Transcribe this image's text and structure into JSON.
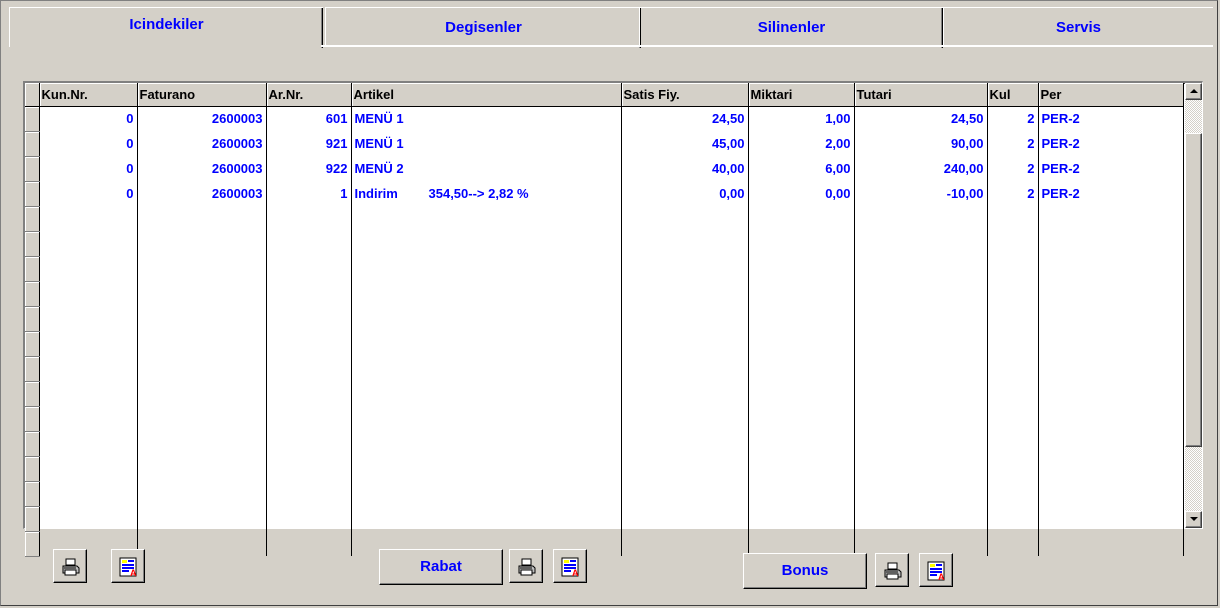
{
  "tabs": [
    {
      "label": "Icindekiler",
      "active": true
    },
    {
      "label": "Degisenler",
      "active": false
    },
    {
      "label": "Silinenler",
      "active": false
    },
    {
      "label": "Servis",
      "active": false
    }
  ],
  "grid": {
    "columns": [
      "Kun.Nr.",
      "Faturano",
      "Ar.Nr.",
      "Artikel",
      "Satis Fiy.",
      "Miktari",
      "Tutari",
      "Kul",
      "Per"
    ],
    "rows": [
      {
        "kun": "0",
        "fatura": "2600003",
        "ar": "601",
        "artikel": "MENÜ 1",
        "discount": "",
        "satis": "24,50",
        "miktar": "1,00",
        "tutar": "24,50",
        "kul": "2",
        "per": "PER-2"
      },
      {
        "kun": "0",
        "fatura": "2600003",
        "ar": "921",
        "artikel": "MENÜ 1",
        "discount": "",
        "satis": "45,00",
        "miktar": "2,00",
        "tutar": "90,00",
        "kul": "2",
        "per": "PER-2"
      },
      {
        "kun": "0",
        "fatura": "2600003",
        "ar": "922",
        "artikel": "MENÜ 2",
        "discount": "",
        "satis": "40,00",
        "miktar": "6,00",
        "tutar": "240,00",
        "kul": "2",
        "per": "PER-2"
      },
      {
        "kun": "0",
        "fatura": "2600003",
        "ar": "1",
        "artikel": "Indirim",
        "discount": "354,50--> 2,82 %",
        "satis": "0,00",
        "miktar": "0,00",
        "tutar": "-10,00",
        "kul": "2",
        "per": "PER-2"
      }
    ]
  },
  "buttons": {
    "rabat": "Rabat",
    "bonus": "Bonus"
  },
  "icons": {
    "print": "printer-icon",
    "report": "report-icon"
  },
  "colors": {
    "text_accent": "#0000ff",
    "window_bg": "#d4d0c8"
  }
}
